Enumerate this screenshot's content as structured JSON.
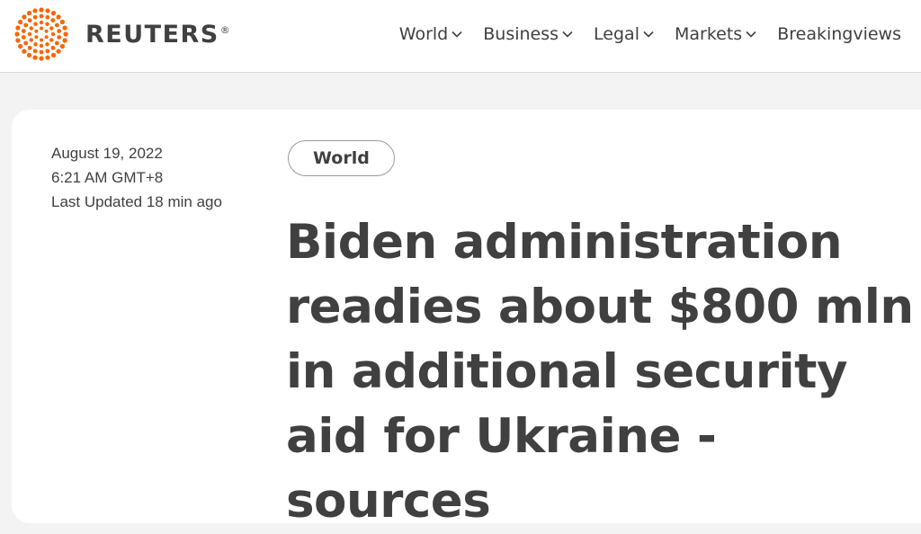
{
  "header": {
    "logo_text": "REUTERS",
    "logo_mark": "®",
    "nav": [
      {
        "label": "World",
        "has_dropdown": true
      },
      {
        "label": "Business",
        "has_dropdown": true
      },
      {
        "label": "Legal",
        "has_dropdown": true
      },
      {
        "label": "Markets",
        "has_dropdown": true
      },
      {
        "label": "Breakingviews",
        "has_dropdown": false
      }
    ]
  },
  "article": {
    "date": "August 19, 2022",
    "time": "6:21 AM GMT+8",
    "updated": "Last Updated 18 min ago",
    "section_tag": "World",
    "headline": "Biden administration readies about $800 mln in additional security aid for Ukraine -sources"
  },
  "colors": {
    "brand_orange": "#fa6400",
    "text": "#404040",
    "page_bg": "#f3f3f3",
    "card_bg": "#ffffff"
  },
  "icons": {
    "logo": "reuters-dot-sphere-icon",
    "dropdown": "chevron-down-icon"
  }
}
